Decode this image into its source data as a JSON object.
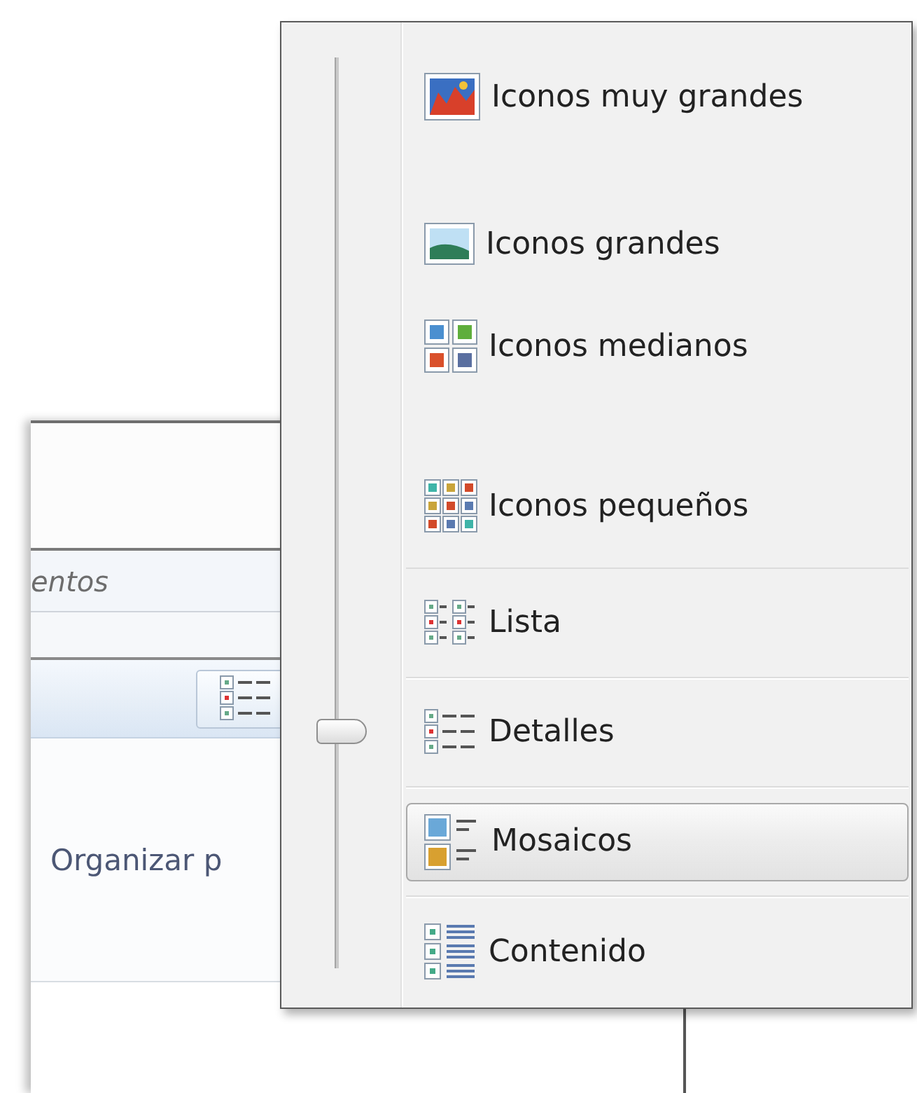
{
  "background_window": {
    "search": {
      "placeholder": "entos"
    },
    "arrange_label": "Organizar p"
  },
  "view_menu": {
    "slider": {
      "level": 0.26
    },
    "items": [
      {
        "label": "Iconos muy grandes",
        "kind": "extra-large",
        "hovered": false
      },
      {
        "label": "Iconos grandes",
        "kind": "large",
        "hovered": false
      },
      {
        "label": "Iconos medianos",
        "kind": "medium",
        "hovered": false
      },
      {
        "label": "Iconos pequeños",
        "kind": "small",
        "hovered": false
      },
      {
        "label": "Lista",
        "kind": "list",
        "hovered": false
      },
      {
        "label": "Detalles",
        "kind": "details",
        "hovered": false
      },
      {
        "label": "Mosaicos",
        "kind": "tiles",
        "hovered": true
      },
      {
        "label": "Contenido",
        "kind": "content",
        "hovered": false
      }
    ]
  }
}
